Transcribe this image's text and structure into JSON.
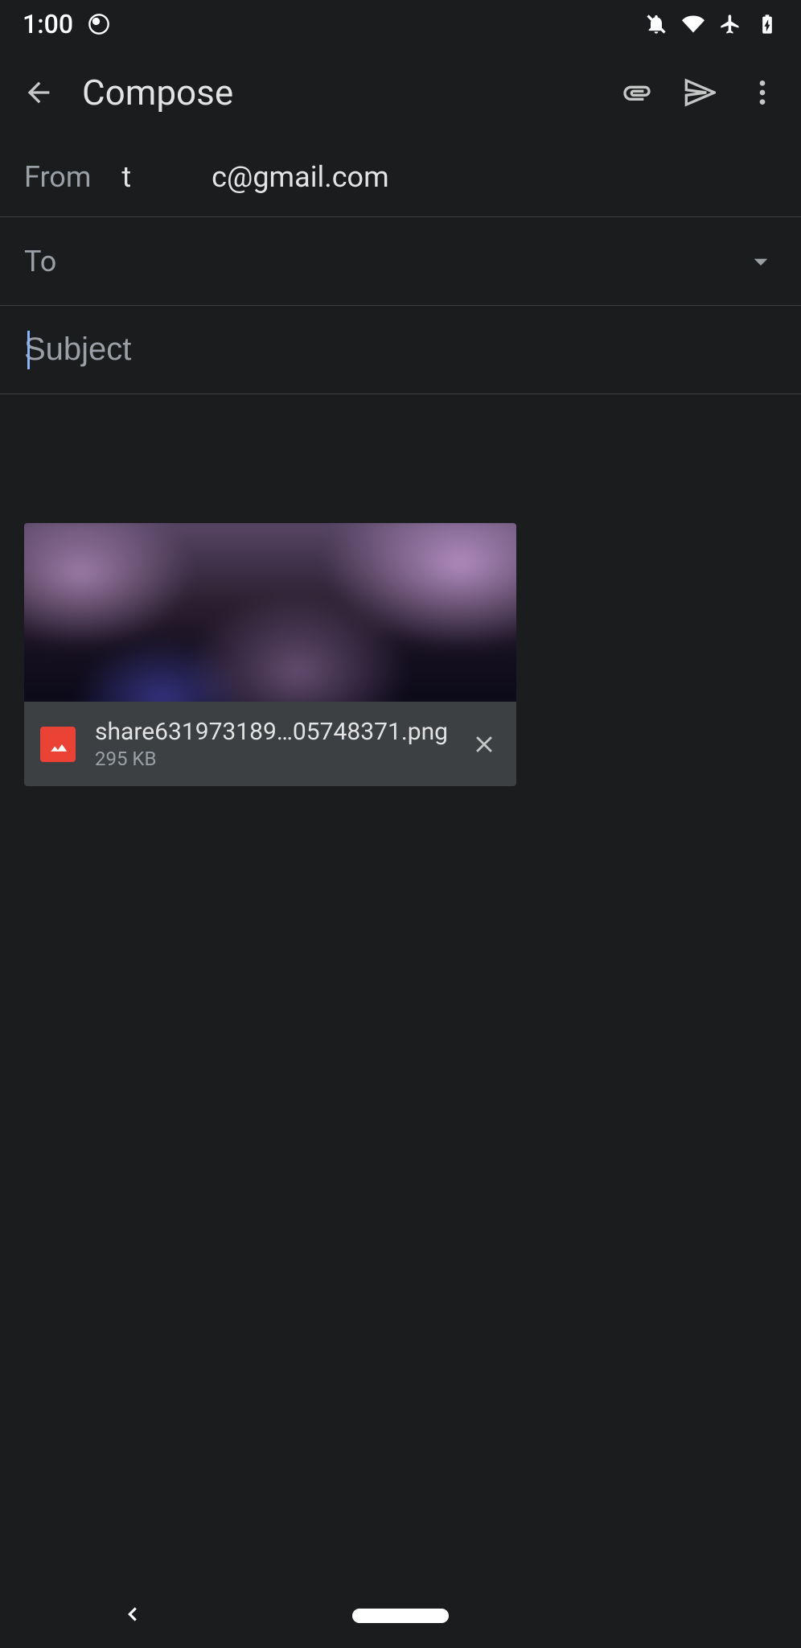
{
  "statusBar": {
    "time": "1:00"
  },
  "appBar": {
    "title": "Compose"
  },
  "from": {
    "label": "From",
    "valuePart1": "t",
    "valuePart2": "c@gmail.com"
  },
  "to": {
    "label": "To"
  },
  "subject": {
    "placeholder": "Subject"
  },
  "attachment": {
    "filename": "share631973189…05748371.png",
    "size": "295 KB"
  }
}
